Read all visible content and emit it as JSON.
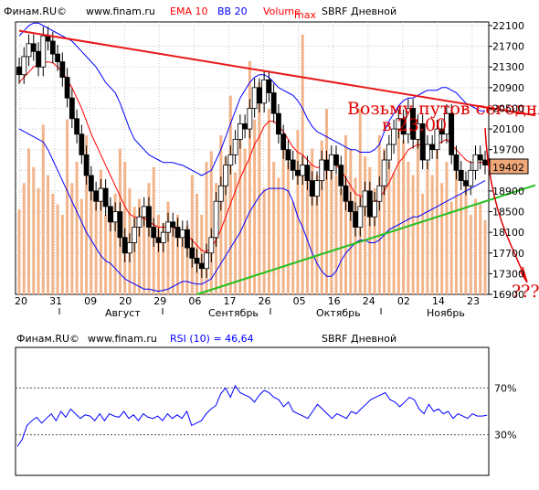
{
  "colors": {
    "ema": "#ff0000",
    "bb": "#0000ff",
    "volume": "#f2b48a",
    "rsi": "#0000ff",
    "trend_upper": "#e81818",
    "trend_lower": "#22c01e",
    "annotation": "#e00000",
    "last_price_box": "#f0a878"
  },
  "main_header": {
    "source": "Финам.RU©",
    "url": "www.finam.ru",
    "ema": "EMA 10",
    "bb": "BB 20",
    "volume": "Volume",
    "volume_sub": "max",
    "title": "SBRF Дневной"
  },
  "rsi_header": {
    "source": "Финам.RU©",
    "url": "www.finam.ru",
    "rsi": "RSI (10) = 46,64",
    "title": "SBRF Дневной"
  },
  "annotation": {
    "line1": "Возьму путов сегодня",
    "line2": "в 23.00",
    "question": "???"
  },
  "chart_data": [
    {
      "type": "candlestick",
      "title": "SBRF Дневной",
      "y_ticks": [
        "22100",
        "21700",
        "21300",
        "20900",
        "20500",
        "20100",
        "19700",
        "19300",
        "18900",
        "18500",
        "18100",
        "17700",
        "17300",
        "16900"
      ],
      "ylim": [
        16900,
        22100
      ],
      "x_day_labels": [
        "20",
        "31",
        "09",
        "20",
        "29",
        "06",
        "17",
        "26",
        "05",
        "16",
        "24",
        "02",
        "14",
        "23"
      ],
      "x_month_labels": [
        "Август",
        "Сентябрь",
        "Октябрь",
        "Ноябрь"
      ],
      "last_price": "19402",
      "close": [
        21150,
        21500,
        21750,
        21600,
        21300,
        21900,
        21800,
        21550,
        21400,
        21100,
        20700,
        20300,
        20000,
        19600,
        19200,
        18900,
        18700,
        18950,
        18600,
        18300,
        18500,
        18000,
        17700,
        17900,
        18200,
        18400,
        18600,
        18200,
        18000,
        17900,
        18100,
        18300,
        18200,
        18000,
        18150,
        17800,
        17600,
        17500,
        17400,
        17700,
        18000,
        18700,
        19000,
        19400,
        19600,
        19900,
        20200,
        20100,
        20500,
        20900,
        20600,
        21050,
        20800,
        20400,
        20000,
        19700,
        19500,
        19300,
        19200,
        19400,
        19100,
        18800,
        19100,
        19500,
        19300,
        19600,
        19400,
        19000,
        18700,
        18500,
        18200,
        18600,
        18900,
        18400,
        18700,
        19000,
        19500,
        19800,
        20100,
        20300,
        20000,
        20500,
        19900,
        20200,
        19500,
        19800,
        19700,
        20100,
        20000,
        20400,
        19600,
        19300,
        19100,
        19000,
        19300,
        19600,
        19500,
        19402
      ],
      "ema10": [
        21000,
        21100,
        21200,
        21300,
        21350,
        21380,
        21400,
        21380,
        21300,
        21200,
        21050,
        20900,
        20700,
        20500,
        20250,
        20000,
        19800,
        19600,
        19400,
        19200,
        19000,
        18800,
        18600,
        18450,
        18400,
        18350,
        18380,
        18300,
        18250,
        18200,
        18200,
        18210,
        18200,
        18150,
        18120,
        18050,
        17950,
        17850,
        17750,
        17720,
        17800,
        17950,
        18150,
        18400,
        18650,
        18900,
        19150,
        19350,
        19550,
        19800,
        19950,
        20150,
        20250,
        20250,
        20150,
        20050,
        19900,
        19750,
        19650,
        19600,
        19500,
        19400,
        19350,
        19380,
        19360,
        19400,
        19400,
        19300,
        19150,
        19000,
        18850,
        18800,
        18800,
        18700,
        18700,
        18750,
        18900,
        19050,
        19250,
        19450,
        19550,
        19700,
        19750,
        19800,
        19780,
        19780,
        19760,
        19800,
        19850,
        19900,
        19800,
        19700,
        19600,
        19500,
        19450,
        19450,
        19450,
        19450
      ],
      "bb_upper": [
        21900,
        22000,
        22100,
        22150,
        22150,
        22100,
        22050,
        22000,
        21950,
        21900,
        21850,
        21800,
        21700,
        21600,
        21500,
        21400,
        21300,
        21150,
        21000,
        20900,
        20800,
        20600,
        20350,
        20100,
        19900,
        19800,
        19700,
        19600,
        19550,
        19500,
        19450,
        19450,
        19450,
        19420,
        19400,
        19350,
        19300,
        19250,
        19200,
        19250,
        19300,
        19500,
        19700,
        19950,
        20200,
        20450,
        20700,
        20850,
        21000,
        21100,
        21150,
        21150,
        21100,
        21000,
        20900,
        20850,
        20800,
        20750,
        20650,
        20500,
        20300,
        20150,
        20050,
        20000,
        19950,
        19900,
        19850,
        19800,
        19750,
        19700,
        19700,
        19650,
        19650,
        19650,
        19700,
        19800,
        20050,
        20250,
        20400,
        20550,
        20650,
        20700,
        20700,
        20750,
        20800,
        20850,
        20850,
        20850,
        20900,
        20900,
        20850,
        20800,
        20700,
        20600,
        20550,
        20500,
        20450,
        20450
      ],
      "bb_lower": [
        20100,
        20050,
        20000,
        19950,
        19900,
        19850,
        19700,
        19500,
        19300,
        19100,
        18900,
        18700,
        18500,
        18300,
        18100,
        17950,
        17800,
        17650,
        17550,
        17500,
        17400,
        17300,
        17200,
        17150,
        17100,
        17050,
        17000,
        17000,
        16980,
        16960,
        16980,
        17000,
        17050,
        17100,
        17150,
        17150,
        17120,
        17100,
        17100,
        17150,
        17200,
        17350,
        17500,
        17650,
        17800,
        17950,
        18100,
        18300,
        18500,
        18650,
        18800,
        18900,
        18950,
        18950,
        18950,
        18950,
        18900,
        18700,
        18400,
        18200,
        17950,
        17700,
        17500,
        17350,
        17250,
        17250,
        17350,
        17550,
        17700,
        17800,
        17900,
        17950,
        17950,
        17900,
        17900,
        17950,
        18050,
        18150,
        18200,
        18250,
        18300,
        18350,
        18400,
        18400,
        18450,
        18500,
        18550,
        18600,
        18650,
        18700,
        18750,
        18800,
        18850,
        18900,
        18950,
        19000,
        19050,
        19100
      ],
      "volume_relative": [
        0.32,
        0.42,
        0.55,
        0.48,
        0.4,
        0.64,
        0.45,
        0.38,
        0.34,
        0.3,
        0.66,
        0.42,
        0.5,
        0.36,
        0.6,
        0.44,
        0.35,
        0.47,
        0.3,
        0.28,
        0.38,
        0.55,
        0.5,
        0.4,
        0.33,
        0.36,
        0.3,
        0.42,
        0.48,
        0.3,
        0.27,
        0.35,
        0.25,
        0.3,
        0.22,
        0.26,
        0.45,
        0.38,
        0.3,
        0.5,
        0.54,
        0.42,
        0.6,
        0.52,
        0.75,
        0.46,
        0.62,
        0.55,
        0.88,
        0.66,
        0.8,
        0.4,
        0.7,
        0.5,
        0.44,
        0.56,
        0.5,
        0.35,
        0.62,
        0.98,
        0.48,
        0.55,
        0.45,
        0.58,
        0.7,
        0.5,
        0.45,
        0.4,
        0.6,
        0.55,
        0.44,
        0.7,
        0.52,
        0.48,
        0.4,
        0.6,
        0.55,
        0.5,
        0.46,
        0.65,
        0.58,
        0.5,
        0.45,
        0.6,
        0.38,
        0.5,
        0.45,
        0.56,
        0.42,
        0.5,
        0.35,
        0.48,
        0.38,
        0.42,
        0.3,
        0.36,
        0.34,
        0.28
      ],
      "trendline_upper": [
        [
          0,
          22000
        ],
        [
          97,
          20150
        ]
      ],
      "trendline_lower": [
        [
          37,
          16900
        ],
        [
          97,
          18800
        ]
      ]
    },
    {
      "type": "line",
      "title": "SBRF Дневной",
      "series": [
        {
          "name": "RSI (10) = 46,64",
          "values": [
            20,
            26,
            38,
            42,
            45,
            40,
            44,
            48,
            42,
            50,
            45,
            52,
            48,
            44,
            47,
            46,
            42,
            48,
            42,
            48,
            46,
            45,
            50,
            44,
            47,
            42,
            48,
            45,
            44,
            46,
            42,
            48,
            44,
            47,
            44,
            50,
            38,
            40,
            42,
            48,
            52,
            55,
            65,
            70,
            62,
            72,
            66,
            64,
            62,
            58,
            64,
            68,
            66,
            62,
            60,
            54,
            58,
            50,
            48,
            46,
            44,
            50,
            56,
            52,
            48,
            44,
            48,
            46,
            44,
            50,
            48,
            52,
            56,
            60,
            62,
            64,
            66,
            60,
            58,
            54,
            58,
            62,
            60,
            52,
            48,
            56,
            50,
            52,
            48,
            50,
            44,
            48,
            46,
            44,
            48,
            46,
            46,
            46.64
          ]
        }
      ],
      "y_ticks": [
        "70%",
        "30%"
      ],
      "ylim": [
        0,
        100
      ],
      "reference_lines": [
        70,
        30
      ]
    }
  ]
}
